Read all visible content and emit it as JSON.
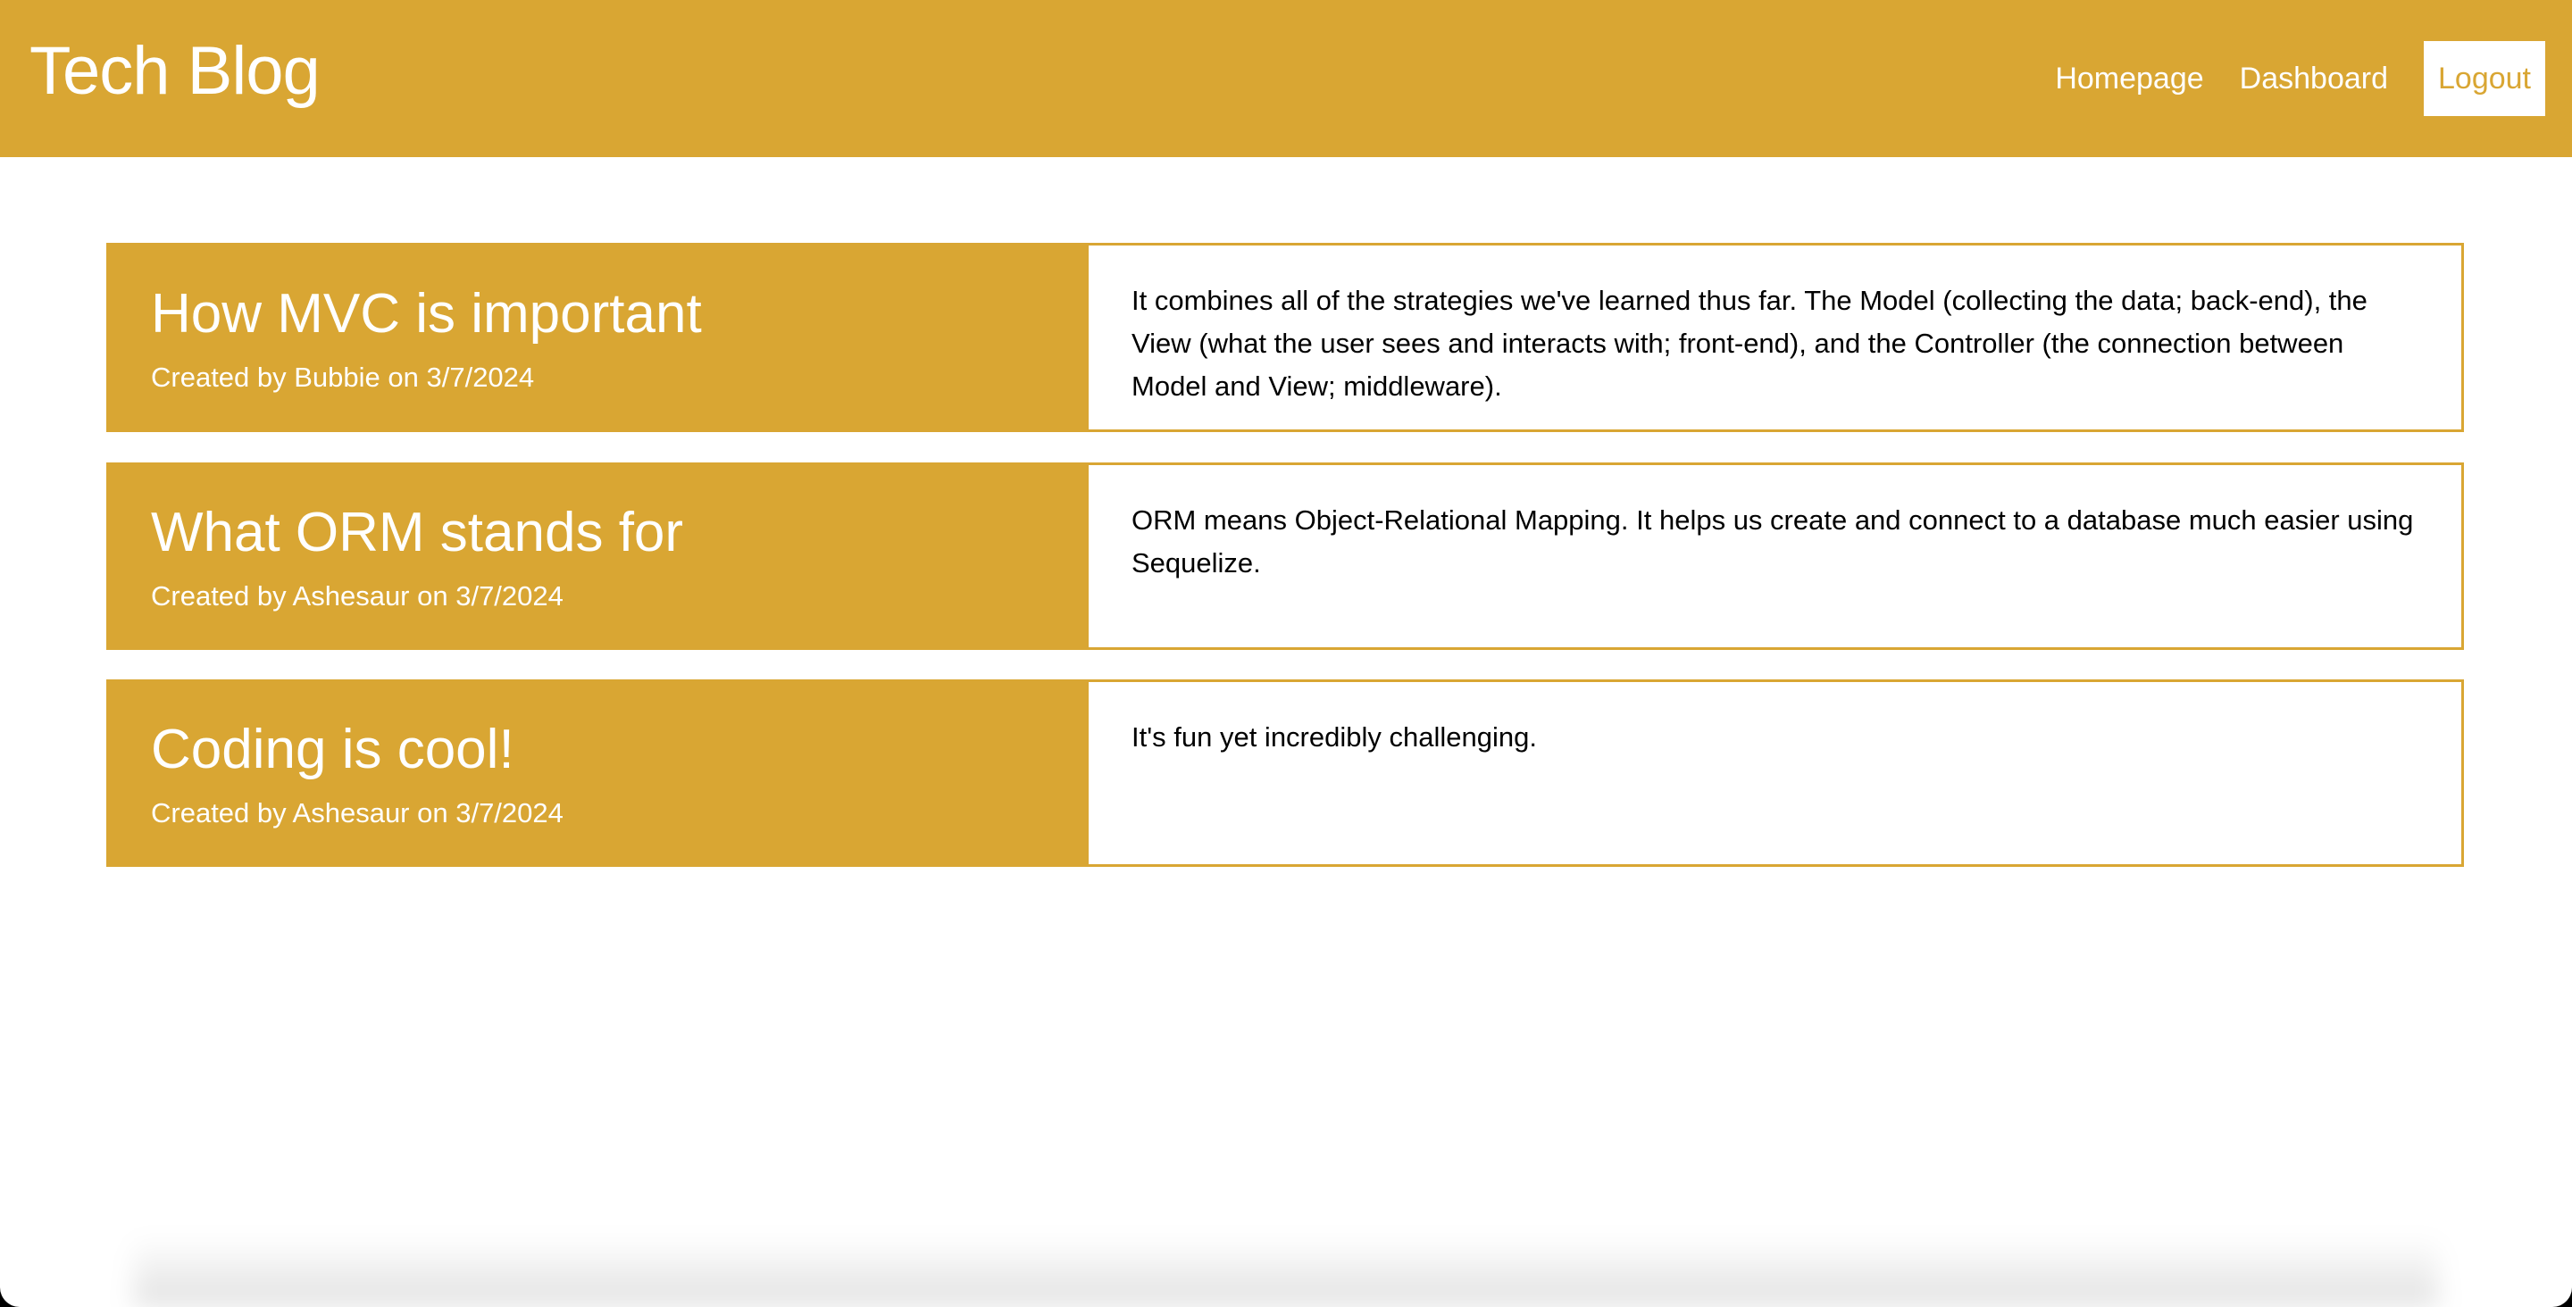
{
  "header": {
    "title": "Tech Blog",
    "nav": {
      "homepage": "Homepage",
      "dashboard": "Dashboard",
      "logout": "Logout"
    }
  },
  "posts": [
    {
      "title": "How MVC is important",
      "meta": "Created by Bubbie on 3/7/2024",
      "body": "It combines all of the strategies we've learned thus far. The Model (collecting the data; back-end), the View (what the user sees and interacts with; front-end), and the Controller (the connection between Model and View; middleware)."
    },
    {
      "title": "What ORM stands for",
      "meta": "Created by Ashesaur on 3/7/2024",
      "body": "ORM means Object-Relational Mapping. It helps us create and connect to a database much easier using Sequelize."
    },
    {
      "title": "Coding is cool!",
      "meta": "Created by Ashesaur on 3/7/2024",
      "body": "It's fun yet incredibly challenging."
    }
  ],
  "colors": {
    "accent": "#d9a633"
  }
}
